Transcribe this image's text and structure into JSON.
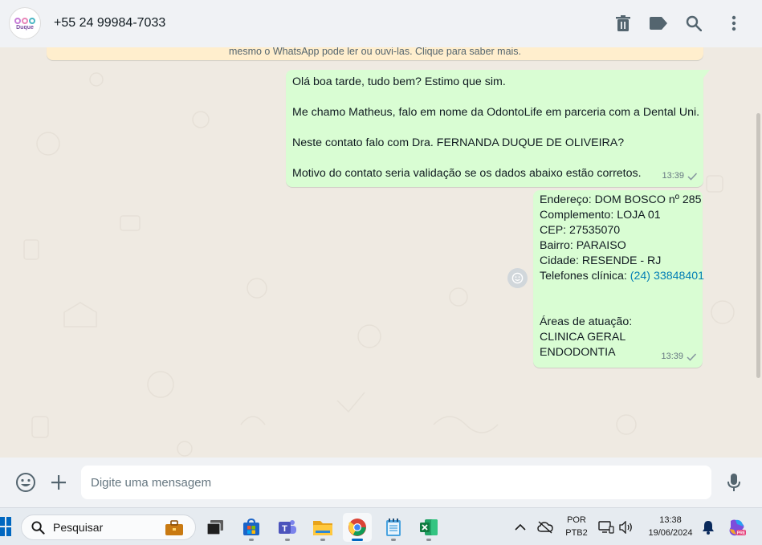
{
  "header": {
    "contact_name": "+55 24 99984-7033",
    "avatar_text": "Duque",
    "icons": [
      "delete-icon",
      "label-icon",
      "search-icon",
      "menu-icon"
    ]
  },
  "chat": {
    "notice_text": "mesmo o WhatsApp pode ler ou ouvi-las. Clique para saber mais.",
    "messages": [
      {
        "lines": [
          "Olá boa tarde, tudo bem? Estimo que sim.",
          "",
          "Me chamo Matheus, falo em nome da OdontoLife em parceria com a Dental Uni.",
          "",
          "Neste contato falo com Dra. FERNANDA DUQUE DE OLIVEIRA?",
          "",
          "Motivo do contato seria validação se os dados abaixo estão corretos."
        ],
        "time": "13:39"
      },
      {
        "endereco": "Endereço: DOM BOSCO nº 285",
        "complemento": "Complemento: LOJA 01",
        "cep": "CEP: 27535070",
        "bairro": "Bairro: PARAISO",
        "cidade": "Cidade: RESENDE - RJ",
        "telefones_label": "Telefones clínica: ",
        "telefones_link": "(24) 33848401",
        "areas_label": "Áreas de atuação:",
        "area1": "CLINICA GERAL",
        "area2": "ENDODONTIA",
        "time": "13:39"
      }
    ]
  },
  "composer": {
    "placeholder": "Digite uma mensagem"
  },
  "taskbar": {
    "search_placeholder": "Pesquisar",
    "lang_top": "POR",
    "lang_bottom": "PTB2",
    "clock_time": "13:38",
    "clock_date": "19/06/2024"
  },
  "colors": {
    "bubble_out": "#d9fdd3",
    "chat_bg": "#efeae2",
    "header_bg": "#f0f2f5",
    "link": "#027eb5",
    "accent": "#0067c0"
  }
}
